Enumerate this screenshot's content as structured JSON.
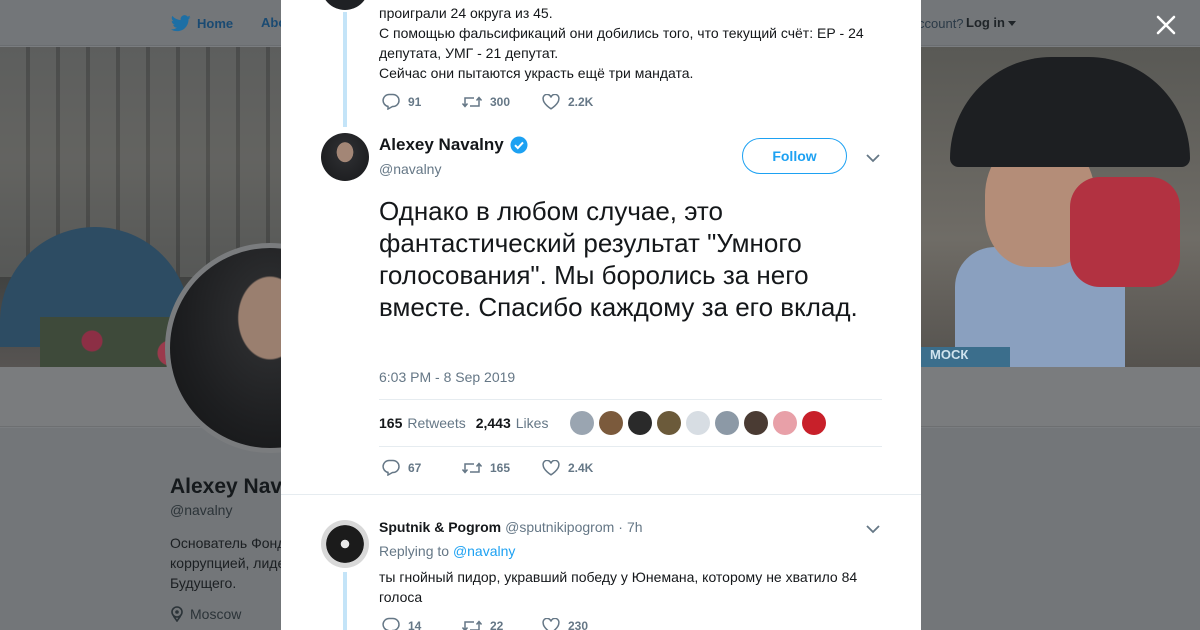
{
  "nav": {
    "home_label": "Home",
    "about_label": "Abo",
    "account_text": "ccount?",
    "login_label": "Log in"
  },
  "profile_bg": {
    "name": "Alexey Nav",
    "handle": "@navalny",
    "bio": "Основатель Фонд коррупцией, лиде Будущего.",
    "location": "Moscow",
    "banner_sign": "МОСК"
  },
  "prev_tweet": {
    "text_lines": [
      "проиграли 24 округа из 45.",
      "С помощью фальсификаций они добились того, что текущий счёт: ЕР - 24",
      "депутата, УМГ - 21 депутат.",
      "Сейчас они пытаются украсть ещё три мандата."
    ],
    "replies": "91",
    "retweets": "300",
    "likes": "2.2K"
  },
  "main_tweet": {
    "name": "Alexey Navalny",
    "handle": "@navalny",
    "follow_label": "Follow",
    "text": "Однако в любом случае, это фантастический результат \"Умного голосования\". Мы боролись за него вместе. Спасибо каждому за его вклад.",
    "timestamp": "6:03 PM - 8 Sep 2019",
    "retweet_count": "165",
    "retweet_label": "Retweets",
    "like_count": "2,443",
    "like_label": "Likes",
    "replies": "67",
    "retweets": "165",
    "likes": "2.4K",
    "liker_colors": [
      "#9aa5b1",
      "#7b5a3c",
      "#2a2a2a",
      "#6b5a3a",
      "#d7dde3",
      "#8c99a6",
      "#4a3b33",
      "#e8a0a8",
      "#c8202a"
    ]
  },
  "reply_tweet": {
    "name": "Sputnik & Pogrom",
    "handle": "@sputnikipogrom",
    "sep": "·",
    "time": "7h",
    "replying_label": "Replying to",
    "replying_handle": "@navalny",
    "text": "ты гнойный пидор, укравший победу у Юнемана, которому не хватило 84 голоса",
    "replies": "14",
    "retweets": "22",
    "likes": "230"
  },
  "colors": {
    "accent": "#1da1f2",
    "thread_line": "#c4e4f8",
    "secondary_text": "#657786"
  }
}
